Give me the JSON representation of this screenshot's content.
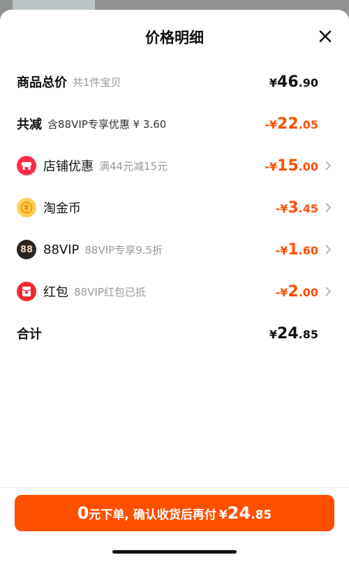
{
  "title": "价格明细",
  "rows": {
    "total": {
      "label": "商品总价",
      "sub": "共1件宝贝",
      "sym": "¥",
      "int": "46",
      "dec": ".90"
    },
    "discount": {
      "label": "共减",
      "sub": "含88VIP专享优惠 ¥ 3.60",
      "sym": "-¥",
      "int": "22",
      "dec": ".05"
    },
    "shop": {
      "label": "店铺优惠",
      "sub": "满44元减15元",
      "sym": "-¥",
      "int": "15",
      "dec": ".00"
    },
    "coin": {
      "label": "淘金币",
      "sub": "",
      "sym": "-¥",
      "int": "3",
      "dec": ".45"
    },
    "vip": {
      "label": "88VIP",
      "sub": "88VIP专享9.5折",
      "sym": "-¥",
      "int": "1",
      "dec": ".60",
      "icon_text": "88"
    },
    "redpacket": {
      "label": "红包",
      "sub": "88VIP红包已抵",
      "sym": "-¥",
      "int": "2",
      "dec": ".00"
    },
    "sum": {
      "label": "合计",
      "sym": "¥",
      "int": "24",
      "dec": ".85"
    }
  },
  "cta": {
    "zero": "0",
    "text": "元下单,",
    "text2": "确认收货后再付",
    "sym": "¥",
    "int": "24",
    "dec": ".85"
  },
  "icons": {
    "close": "close-icon",
    "shop": "shop-icon",
    "coin": "coin-icon",
    "vip": "vip-88-icon",
    "redpacket": "red-packet-icon",
    "chevron": "chevron-right-icon"
  },
  "colors": {
    "accent": "#ff5000",
    "text": "#111111",
    "muted": "#999999"
  }
}
